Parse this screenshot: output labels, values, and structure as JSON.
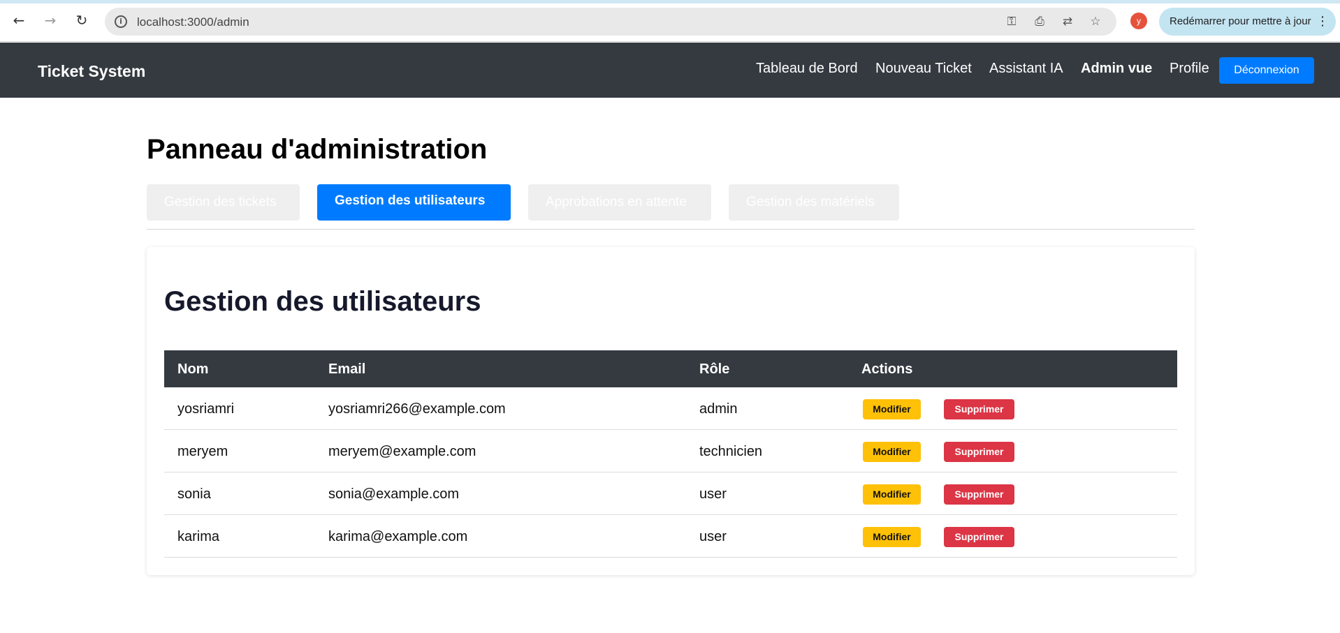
{
  "browser": {
    "url": "localhost:3000/admin",
    "profile_initial": "y",
    "update_label": "Redémarrer pour mettre à jour"
  },
  "header": {
    "brand": "Ticket System",
    "nav": [
      {
        "label": "Tableau de Bord"
      },
      {
        "label": "Nouveau Ticket"
      },
      {
        "label": "Assistant IA"
      },
      {
        "label": "Admin vue"
      },
      {
        "label": "Profile"
      }
    ],
    "logout_label": "Déconnexion"
  },
  "page": {
    "title": "Panneau d'administration",
    "tabs": [
      {
        "label": "Gestion des tickets"
      },
      {
        "label": "Gestion des utilisateurs"
      },
      {
        "label": "Approbations en attente"
      },
      {
        "label": "Gestion des matériels"
      }
    ]
  },
  "users": {
    "title": "Gestion des utilisateurs",
    "columns": [
      "Nom",
      "Email",
      "Rôle",
      "Actions"
    ],
    "rows": [
      {
        "name": "yosriamri",
        "email": "yosriamri266@example.com",
        "role": "admin"
      },
      {
        "name": "meryem",
        "email": "meryem@example.com",
        "role": "technicien"
      },
      {
        "name": "sonia",
        "email": "sonia@example.com",
        "role": "user"
      },
      {
        "name": "karima",
        "email": "karima@example.com",
        "role": "user"
      }
    ],
    "edit_label": "Modifier",
    "delete_label": "Supprimer"
  },
  "colors": {
    "header_bg": "#343a40",
    "primary": "#007bff",
    "warning": "#ffc107",
    "danger": "#dc3545"
  }
}
